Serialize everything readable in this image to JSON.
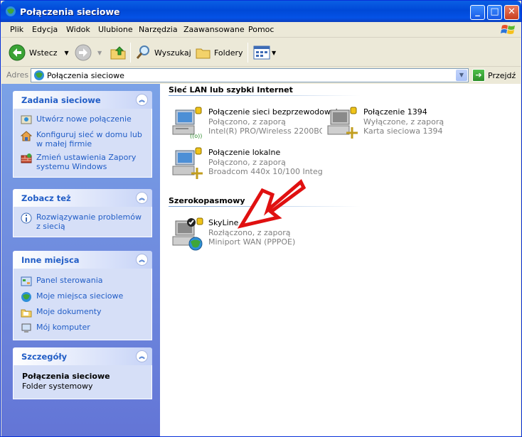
{
  "window": {
    "title": "Połączenia sieciowe"
  },
  "menu": [
    "Plik",
    "Edycja",
    "Widok",
    "Ulubione",
    "Narzędzia",
    "Zaawansowane",
    "Pomoc"
  ],
  "toolbar": {
    "back": "Wstecz",
    "search": "Wyszukaj",
    "folders": "Foldery"
  },
  "address": {
    "label": "Adres",
    "value": "Połączenia sieciowe",
    "go": "Przejdź"
  },
  "sidebar": {
    "network_tasks": {
      "title": "Zadania sieciowe",
      "items": [
        "Utwórz nowe połączenie",
        "Konfiguruj sieć w domu lub w małej firmie",
        "Zmień ustawienia Zapory systemu Windows"
      ]
    },
    "see_also": {
      "title": "Zobacz też",
      "items": [
        "Rozwiązywanie problemów z siecią"
      ]
    },
    "other_places": {
      "title": "Inne miejsca",
      "items": [
        "Panel sterowania",
        "Moje miejsca sieciowe",
        "Moje dokumenty",
        "Mój komputer"
      ]
    },
    "details": {
      "title": "Szczegóły",
      "name": "Połączenia sieciowe",
      "type": "Folder systemowy"
    }
  },
  "groups": {
    "lan": {
      "title": "Sieć LAN lub szybki Internet",
      "items": [
        {
          "name": "Połączenie sieci bezprzewodowej",
          "status": "Połączono, z zaporą",
          "device": "Intel(R) PRO/Wireless 2200BG..."
        },
        {
          "name": "Połączenie 1394",
          "status": "Wyłączone, z zaporą",
          "device": "Karta sieciowa 1394"
        },
        {
          "name": "Połączenie lokalne",
          "status": "Połączono, z zaporą",
          "device": "Broadcom 440x 10/100 Integr..."
        }
      ]
    },
    "broadband": {
      "title": "Szerokopasmowy",
      "items": [
        {
          "name": "SkyLine",
          "status": "Rozłączono, z zaporą",
          "device": "Miniport WAN (PPPOE)"
        }
      ]
    }
  }
}
